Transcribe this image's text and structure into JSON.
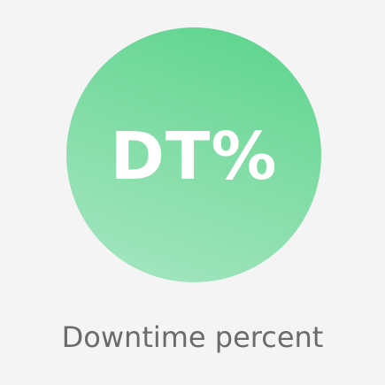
{
  "tile": {
    "abbreviation": "DT%",
    "caption": "Downtime percent"
  },
  "colors": {
    "background": "#f4f4f4",
    "circle_gradient_top": "#59d38b",
    "circle_gradient_bottom": "#a7e6c3",
    "abbreviation_text": "#ffffff",
    "caption_text": "#6b6b6b"
  }
}
